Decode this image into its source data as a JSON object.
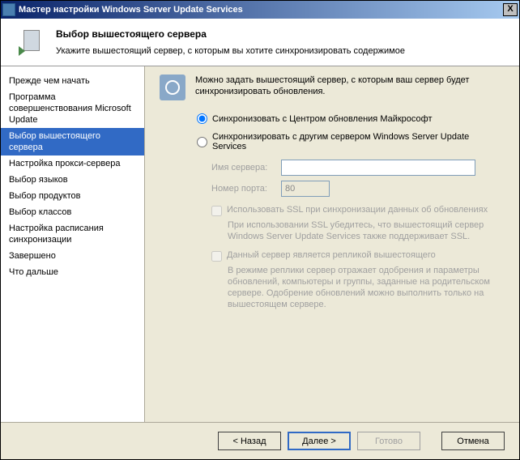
{
  "titlebar": {
    "title": "Мастер настройки Windows Server Update Services",
    "close": "X"
  },
  "header": {
    "title": "Выбор вышестоящего сервера",
    "subtitle": "Укажите вышестоящий сервер, с которым вы хотите синхронизировать содержимое"
  },
  "sidebar": {
    "items": [
      "Прежде чем начать",
      "Программа совершенствования Microsoft Update",
      "Выбор вышестоящего сервера",
      "Настройка прокси-сервера",
      "Выбор языков",
      "Выбор продуктов",
      "Выбор классов",
      "Настройка расписания синхронизации",
      "Завершено",
      "Что дальше"
    ],
    "selected_index": 2
  },
  "content": {
    "intro": "Можно задать вышестоящий сервер, с которым ваш сервер будет синхронизировать обновления.",
    "radio1": "Синхронизовать с Центром обновления Майкрософт",
    "radio2": "Синхронизировать с другим сервером Windows Server Update Services",
    "server_label": "Имя сервера:",
    "server_value": "",
    "port_label": "Номер порта:",
    "port_value": "80",
    "ssl_label": "Использовать SSL при синхронизации данных об обновлениях",
    "ssl_hint": "При использовании SSL убедитесь, что вышестоящий сервер Windows Server Update Services также поддерживает SSL.",
    "replica_label": "Данный сервер является репликой вышестоящего",
    "replica_hint": "В режиме реплики сервер отражает одобрения и параметры обновлений, компьютеры и группы, заданные на родительском сервере. Одобрение обновлений можно выполнить только на вышестоящем сервере."
  },
  "buttons": {
    "back": "< Назад",
    "next": "Далее >",
    "finish": "Готово",
    "cancel": "Отмена"
  }
}
